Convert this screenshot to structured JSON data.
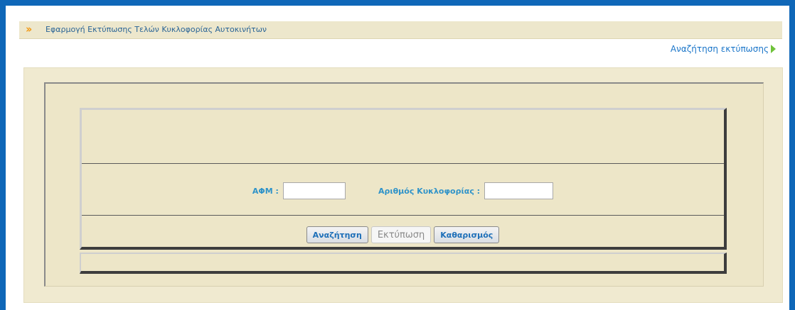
{
  "header": {
    "title": "Εφαρμογή Εκτύπωσης Τελών Κυκλοφορίας Αυτοκινήτων",
    "title_icon": "double-chevron-right-icon",
    "accent_color": "#f29a16"
  },
  "nav": {
    "search_print_link": "Αναζήτηση εκτύπωσης",
    "link_icon": "play-arrow-icon",
    "link_icon_color": "#6fc23a"
  },
  "form": {
    "afm_label": "ΑΦΜ :",
    "afm_value": "",
    "plate_label": "Αριθμός Κυκλοφορίας :",
    "plate_value": ""
  },
  "buttons": {
    "search_label": "Αναζήτηση",
    "print_label": "Εκτύπωση",
    "clear_label": "Καθαρισμός"
  },
  "colors": {
    "window_border": "#0f67b8",
    "panel_background": "#ede6c8",
    "label_color": "#2f93c9"
  }
}
